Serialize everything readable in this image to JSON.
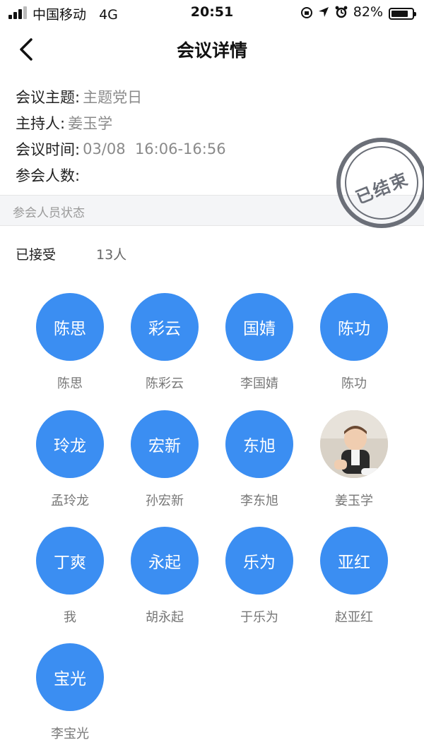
{
  "status_bar": {
    "carrier": "中国移动",
    "network": "4G",
    "time": "20:51",
    "battery_text": "82%",
    "battery_level": 0.82,
    "signal_bars": 3
  },
  "header": {
    "title": "会议详情"
  },
  "meeting": {
    "topic_label": "会议主题:",
    "topic_value": "主题党日",
    "host_label": "主持人:",
    "host_value": "姜玉学",
    "time_label": "会议时间:",
    "time_value": "03/08  16:06-16:56",
    "count_label": "参会人数:",
    "count_value": ""
  },
  "stamp_text": "已结束",
  "section": {
    "title": "参会人员状态"
  },
  "accepted": {
    "label": "已接受",
    "count": "13人"
  },
  "members": [
    {
      "avatar_text": "陈思",
      "name": "陈思"
    },
    {
      "avatar_text": "彩云",
      "name": "陈彩云"
    },
    {
      "avatar_text": "国婧",
      "name": "李国婧"
    },
    {
      "avatar_text": "陈功",
      "name": "陈功"
    },
    {
      "avatar_text": "玲龙",
      "name": "孟玲龙"
    },
    {
      "avatar_text": "宏新",
      "name": "孙宏新"
    },
    {
      "avatar_text": "东旭",
      "name": "李东旭"
    },
    {
      "avatar_text": "",
      "name": "姜玉学",
      "photo": true
    },
    {
      "avatar_text": "丁爽",
      "name": "我"
    },
    {
      "avatar_text": "永起",
      "name": "胡永起"
    },
    {
      "avatar_text": "乐为",
      "name": "于乐为"
    },
    {
      "avatar_text": "亚红",
      "name": "赵亚红"
    },
    {
      "avatar_text": "宝光",
      "name": "李宝光"
    }
  ],
  "colors": {
    "avatar_blue": "#3b8ef2",
    "stamp_gray": "#6b6f78",
    "value_gray": "#8a8a8a"
  }
}
